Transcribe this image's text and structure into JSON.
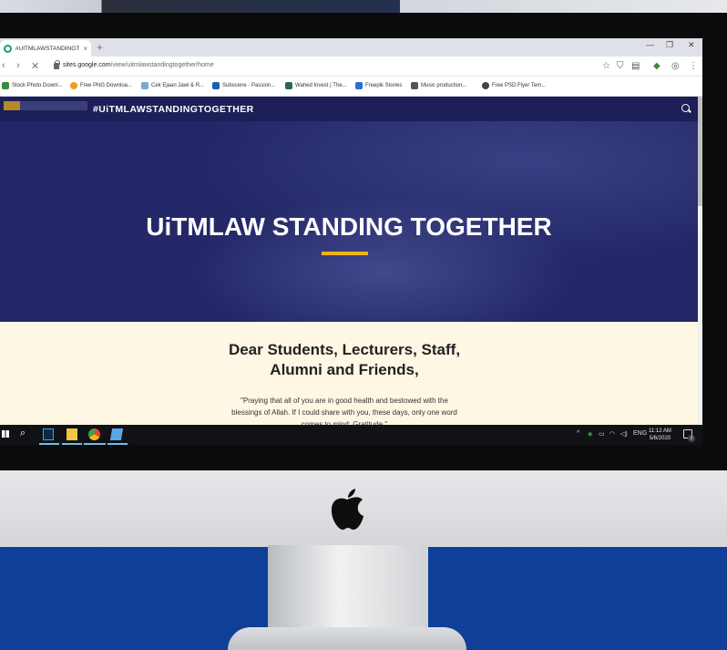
{
  "browser": {
    "tab_title": "#UITMLAWSTANDINGTOGETHER",
    "tab_close": "×",
    "new_tab": "+",
    "window": {
      "minimize": "—",
      "maximize": "❐",
      "close": "✕"
    },
    "nav": {
      "back": "‹",
      "forward": "›",
      "reload": "✕"
    },
    "url_host": "sites.google.com",
    "url_path": "/view/uitmlawstandingtogether/home",
    "bookmarks": [
      {
        "label": "Stock Photo Downl...",
        "color": "#3c8a3e"
      },
      {
        "label": "Free PNG Downloa...",
        "color": "#f29b1d"
      },
      {
        "label": "Cek Ejaan Jawi & R...",
        "color": "#7aa7d6"
      },
      {
        "label": "Subscene - Passion...",
        "color": "#1f5fb0"
      },
      {
        "label": "Wahed Invest | The...",
        "color": "#2a6b4a"
      },
      {
        "label": "Freepik Stories",
        "color": "#2b6fd6"
      },
      {
        "label": "Music production...",
        "color": "#555555"
      },
      {
        "label": "Free PSD Flyer Tem...",
        "color": "#444444"
      }
    ]
  },
  "site": {
    "header_title": "#UiTMLAWSTANDINGTOGETHER",
    "hero_title": "UiTMLAW STANDING TOGETHER",
    "greeting_line1": "Dear Students, Lecturers, Staff,",
    "greeting_line2": "Alumni and Friends,",
    "quote_line1": "\"Praying that all of you are in good health and bestowed with the",
    "quote_line2": "blessings of Allah. If I could share with you, these days, only one word",
    "quote_line3": "comes to mind: Gratitude.\""
  },
  "taskbar": {
    "language": "ENG",
    "time": "11:12 AM",
    "date": "5/6/2020",
    "notifications": "2"
  },
  "colors": {
    "site_header": "#1c1f58",
    "hero": "#232767",
    "accent": "#f2b21b",
    "content_bg": "#fdf7e4",
    "backdrop": "#0d3a8f"
  }
}
